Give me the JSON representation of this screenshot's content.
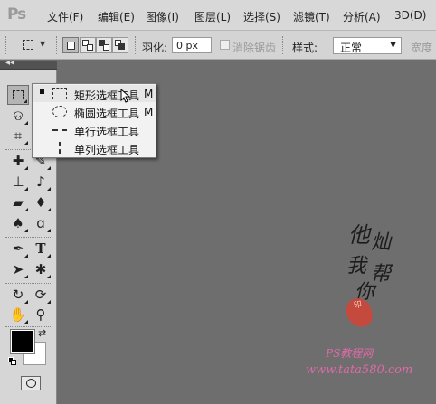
{
  "app": {
    "logo": "Ps",
    "menu": [
      "文件(F)",
      "编辑(E)",
      "图像(I)",
      "图层(L)",
      "选择(S)",
      "滤镜(T)",
      "分析(A)",
      "3D(D)"
    ]
  },
  "options_bar": {
    "feather_label": "羽化:",
    "feather_value": "0 px",
    "antialias_label": "消除锯齿",
    "style_label": "样式:",
    "style_value": "正常",
    "width_label": "宽度"
  },
  "tools_panel": {
    "collapse_glyph": "◂◂",
    "selected_tool": "rectangular-marquee"
  },
  "flyout": {
    "items": [
      {
        "label": "矩形选框工具",
        "shortcut": "M",
        "active": true
      },
      {
        "label": "椭圆选框工具",
        "shortcut": "M",
        "active": false
      },
      {
        "label": "单行选框工具",
        "shortcut": "",
        "active": false
      },
      {
        "label": "单列选框工具",
        "shortcut": "",
        "active": false
      }
    ]
  },
  "watermark": {
    "chars": [
      "他",
      "灿",
      "我",
      "帮",
      "你"
    ],
    "ps_text": "PS教程网",
    "site": "www.tata580.com"
  },
  "colors": {
    "canvas": "#6e6e6e",
    "foreground": "#000000",
    "background": "#ffffff",
    "seal": "#c34a3c",
    "site_text": "#e06aa8"
  }
}
